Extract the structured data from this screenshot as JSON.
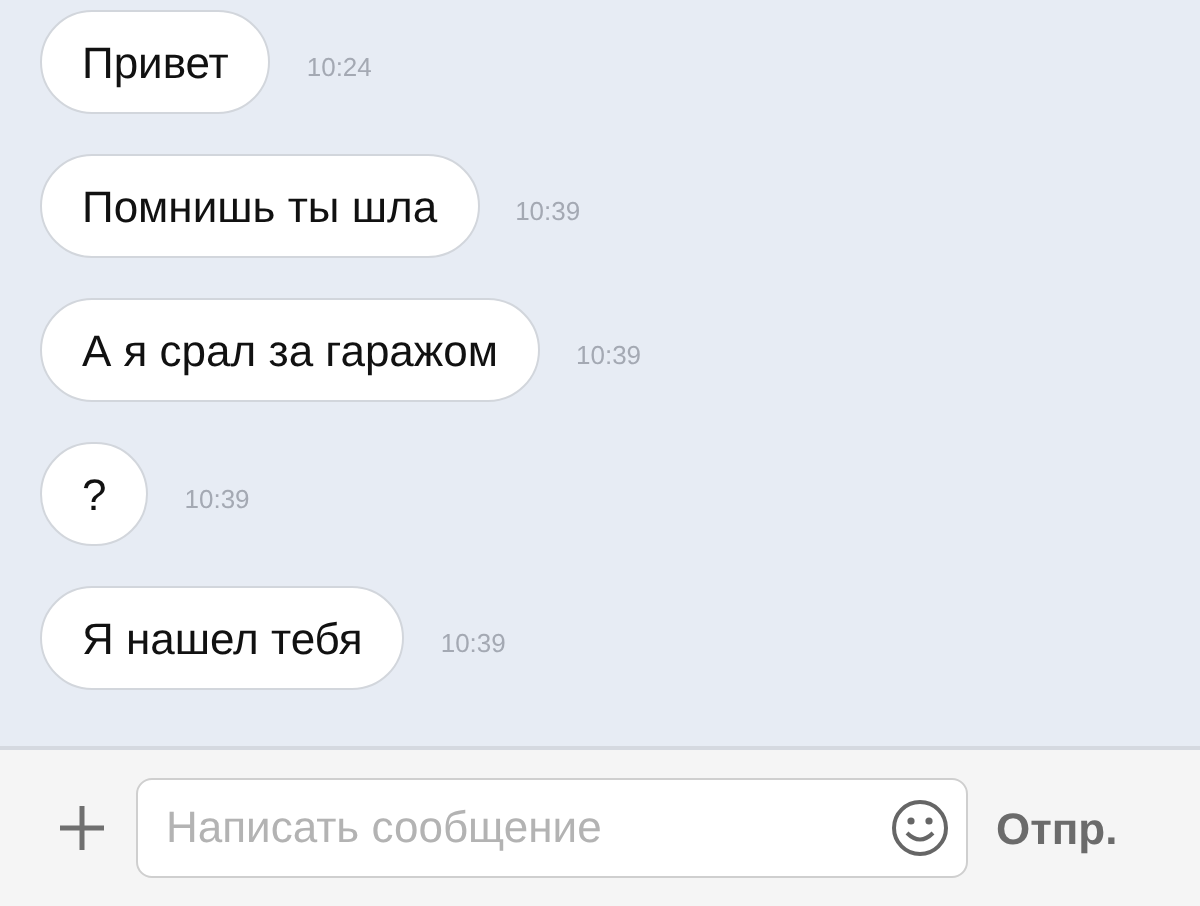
{
  "messages": [
    {
      "text": "Привет",
      "time": "10:24"
    },
    {
      "text": "Помнишь ты шла",
      "time": "10:39"
    },
    {
      "text": "А я срал за гаражом",
      "time": "10:39"
    },
    {
      "text": "?",
      "time": "10:39"
    },
    {
      "text": "Я нашел тебя",
      "time": "10:39"
    }
  ],
  "composer": {
    "placeholder": "Написать сообщение",
    "send": "Отпр."
  }
}
